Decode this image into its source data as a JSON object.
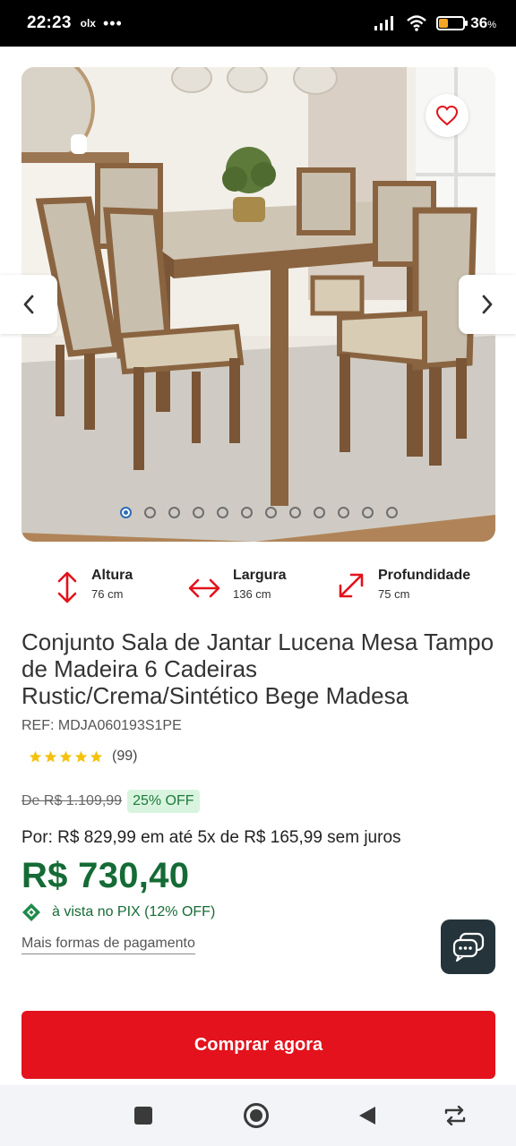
{
  "status_bar": {
    "time": "22:23",
    "notif_app": "olx",
    "more": "•••",
    "battery_percent": "36",
    "battery_unit": "%",
    "battery_level": 0.36
  },
  "gallery": {
    "image_count": 12,
    "active_index": 0
  },
  "dimensions": [
    {
      "label": "Altura",
      "value": "76 cm",
      "icon": "vertical-arrows-icon"
    },
    {
      "label": "Largura",
      "value": "136 cm",
      "icon": "horizontal-arrows-icon"
    },
    {
      "label": "Profundidade",
      "value": "75 cm",
      "icon": "diagonal-arrows-icon"
    }
  ],
  "product": {
    "title": "Conjunto Sala de Jantar Lucena Mesa Tampo de Madeira 6 Cadeiras Rustic/Crema/Sintético Bege Madesa",
    "ref": "REF: MDJA060193S1PE",
    "rating_stars": 5,
    "rating_count": "(99)"
  },
  "pricing": {
    "old_price": "De R$ 1.109,99",
    "discount": "25% OFF",
    "installments": "Por: R$ 829,99 em até 5x de R$ 165,99 sem juros",
    "price": "R$ 730,40",
    "pix_text": "à vista no PIX (12% OFF)",
    "more_payment": "Mais formas de pagamento"
  },
  "actions": {
    "buy_label": "Comprar agora"
  },
  "colors": {
    "accent_red": "#e3121c",
    "price_green": "#156b35",
    "discount_bg": "#d8f4df"
  }
}
